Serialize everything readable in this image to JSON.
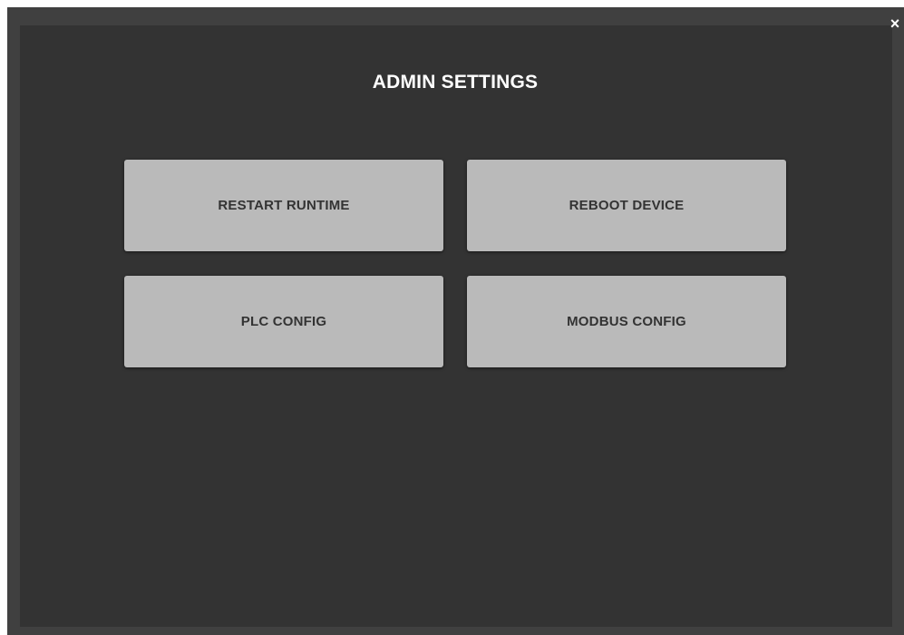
{
  "dialog": {
    "title": "ADMIN SETTINGS",
    "close_label": "×"
  },
  "buttons": {
    "restart_runtime": "RESTART RUNTIME",
    "reboot_device": "REBOOT DEVICE",
    "plc_config": "PLC CONFIG",
    "modbus_config": "MODBUS CONFIG"
  },
  "colors": {
    "frame": "#404040",
    "panel": "#333333",
    "button": "#bababa",
    "button_text": "#333333",
    "title_text": "#ffffff"
  },
  "icons": [
    "close-icon"
  ]
}
